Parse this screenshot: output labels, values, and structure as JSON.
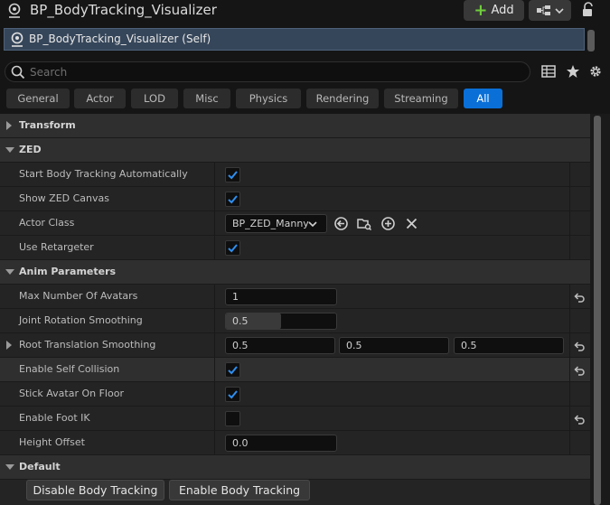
{
  "window": {
    "title": "BP_BodyTracking_Visualizer",
    "add_label": "Add"
  },
  "component": {
    "label": "BP_BodyTracking_Visualizer (Self)"
  },
  "search": {
    "placeholder": "Search"
  },
  "filters": [
    "General",
    "Actor",
    "LOD",
    "Misc",
    "Physics",
    "Rendering",
    "Streaming",
    "All"
  ],
  "active_filter": "All",
  "categories": {
    "transform": "Transform",
    "zed": "ZED",
    "anim": "Anim Parameters",
    "default": "Default"
  },
  "zed": {
    "start_body_tracking": {
      "label": "Start Body Tracking Automatically",
      "checked": true
    },
    "show_zed_canvas": {
      "label": "Show ZED Canvas",
      "checked": true
    },
    "actor_class": {
      "label": "Actor Class",
      "value": "BP_ZED_Manny"
    },
    "use_retargeter": {
      "label": "Use Retargeter",
      "checked": true
    }
  },
  "anim": {
    "max_avatars": {
      "label": "Max Number Of Avatars",
      "value": "1"
    },
    "joint_rotation": {
      "label": "Joint Rotation Smoothing",
      "value": "0.5",
      "fill_fraction": 0.5
    },
    "root_translation": {
      "label": "Root Translation Smoothing",
      "x": "0.5",
      "y": "0.5",
      "z": "0.5"
    },
    "self_collision": {
      "label": "Enable Self Collision",
      "checked": true
    },
    "stick_floor": {
      "label": "Stick Avatar On Floor",
      "checked": true
    },
    "foot_ik": {
      "label": "Enable Foot IK",
      "checked": false
    },
    "height_offset": {
      "label": "Height Offset",
      "value": "0.0"
    }
  },
  "actions": {
    "disable": "Disable Body Tracking",
    "enable": "Enable Body Tracking"
  },
  "colors": {
    "accent": "#0a70d8",
    "selection": "#36465a",
    "add_plus": "#6fcf3c"
  }
}
